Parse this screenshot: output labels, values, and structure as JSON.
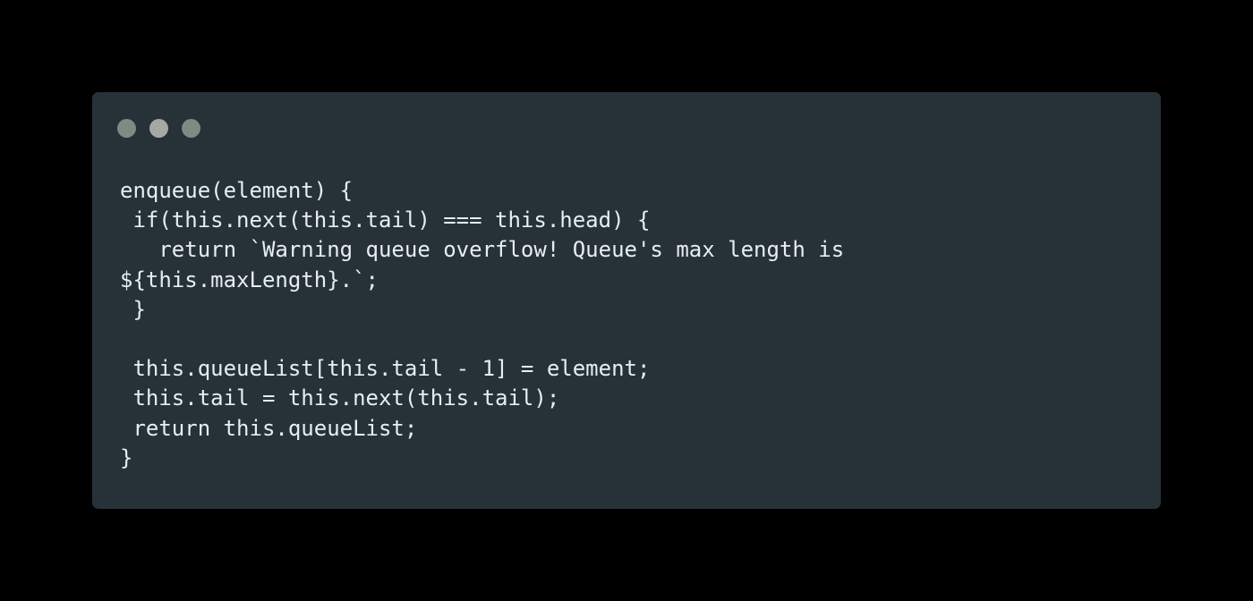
{
  "colors": {
    "page_background": "#000000",
    "window_background": "#263238",
    "code_text": "#e8edef"
  },
  "window_controls": [
    {
      "name": "close-dot",
      "color": "#7e8a83"
    },
    {
      "name": "minimize-dot",
      "color": "#a4a9a4"
    },
    {
      "name": "maximize-dot",
      "color": "#7e8a83"
    }
  ],
  "code": {
    "language": "javascript",
    "lines": [
      "enqueue(element) {",
      " if(this.next(this.tail) === this.head) {",
      "   return `Warning queue overflow! Queue's max length is",
      "${this.maxLength}.`;",
      " }",
      "",
      " this.queueList[this.tail - 1] = element;",
      " this.tail = this.next(this.tail);",
      " return this.queueList;",
      "}"
    ]
  }
}
